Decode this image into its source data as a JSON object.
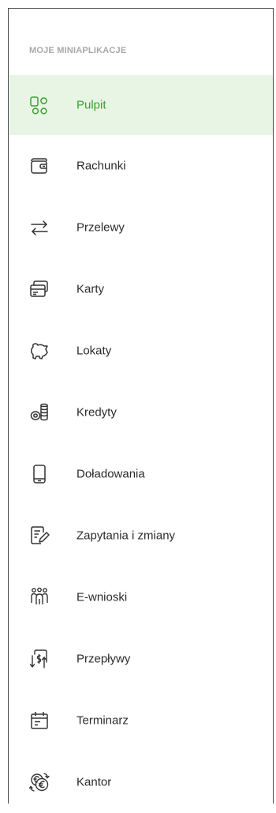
{
  "section_title": "MOJE MINIAPLIKACJE",
  "colors": {
    "active_green": "#3aa12f",
    "active_bg": "#e8f5e5",
    "icon_gray": "#333333"
  },
  "menu": {
    "items": [
      {
        "label": "Pulpit",
        "icon": "dashboard-icon",
        "active": true
      },
      {
        "label": "Rachunki",
        "icon": "wallet-icon"
      },
      {
        "label": "Przelewy",
        "icon": "transfer-arrows-icon"
      },
      {
        "label": "Karty",
        "icon": "card-icon"
      },
      {
        "label": "Lokaty",
        "icon": "piggy-bank-icon"
      },
      {
        "label": "Kredyty",
        "icon": "coins-icon"
      },
      {
        "label": "Doładowania",
        "icon": "phone-icon"
      },
      {
        "label": "Zapytania i zmiany",
        "icon": "edit-document-icon"
      },
      {
        "label": "E-wnioski",
        "icon": "people-icon"
      },
      {
        "label": "Przepływy",
        "icon": "cash-flow-icon"
      },
      {
        "label": "Terminarz",
        "icon": "calendar-icon"
      },
      {
        "label": "Kantor",
        "icon": "currency-exchange-icon"
      }
    ]
  }
}
